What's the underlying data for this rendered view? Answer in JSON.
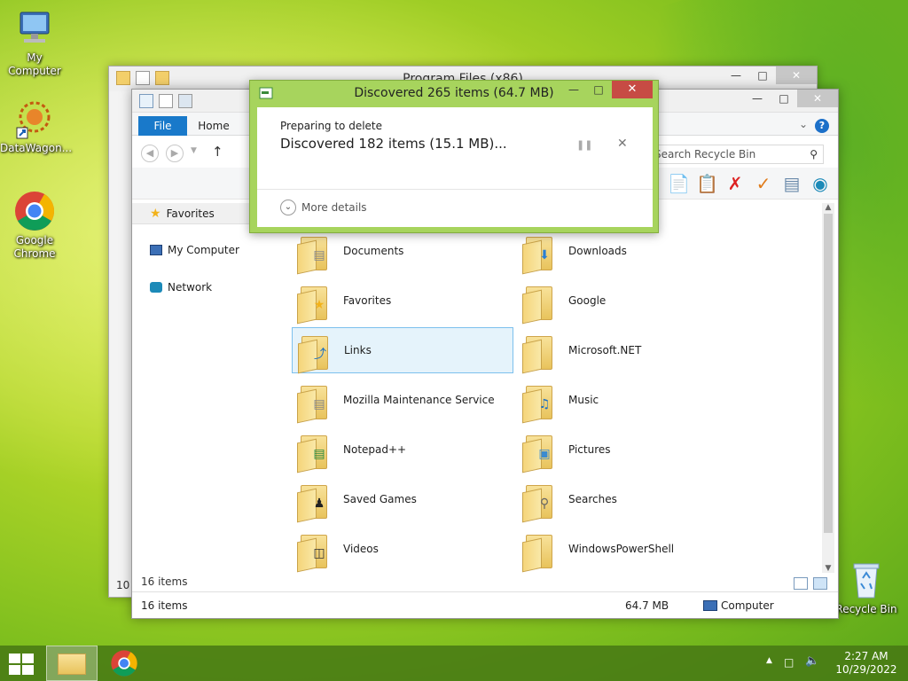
{
  "desktop": {
    "icons": [
      {
        "label": "My Computer"
      },
      {
        "label": "DataWagon..."
      },
      {
        "label": "Google Chrome"
      },
      {
        "label": "Recycle Bin"
      }
    ]
  },
  "back_window": {
    "title": "Program Files (x86)",
    "status_count": "10"
  },
  "front_window": {
    "tabs": {
      "file": "File",
      "home": "Home"
    },
    "search_placeholder": "Search Recycle Bin",
    "nav": {
      "favorites": "Favorites",
      "my_computer": "My Computer",
      "network": "Network"
    },
    "items": [
      {
        "name": "Documents",
        "badge": "doc"
      },
      {
        "name": "Downloads",
        "badge": "arrow-down"
      },
      {
        "name": "Favorites",
        "badge": "star"
      },
      {
        "name": "Google",
        "badge": "none"
      },
      {
        "name": "Links",
        "badge": "link-arrow",
        "selected": true
      },
      {
        "name": "Microsoft.NET",
        "badge": "none"
      },
      {
        "name": "Mozilla Maintenance Service",
        "badge": "doc"
      },
      {
        "name": "Music",
        "badge": "note"
      },
      {
        "name": "Notepad++",
        "badge": "doc"
      },
      {
        "name": "Pictures",
        "badge": "picture"
      },
      {
        "name": "Saved Games",
        "badge": "chess"
      },
      {
        "name": "Searches",
        "badge": "magnifier"
      },
      {
        "name": "Videos",
        "badge": "film"
      },
      {
        "name": "WindowsPowerShell",
        "badge": "none"
      }
    ],
    "status_inner": "16 items",
    "status_items": "16 items",
    "status_size": "64.7 MB",
    "status_computer": "Computer"
  },
  "dialog": {
    "title": "Discovered 265 items (64.7 MB)",
    "preparing": "Preparing to delete",
    "discovered": "Discovered 182 items (15.1 MB)...",
    "more_details": "More details"
  },
  "taskbar": {
    "time": "2:27 AM",
    "date": "10/29/2022"
  }
}
